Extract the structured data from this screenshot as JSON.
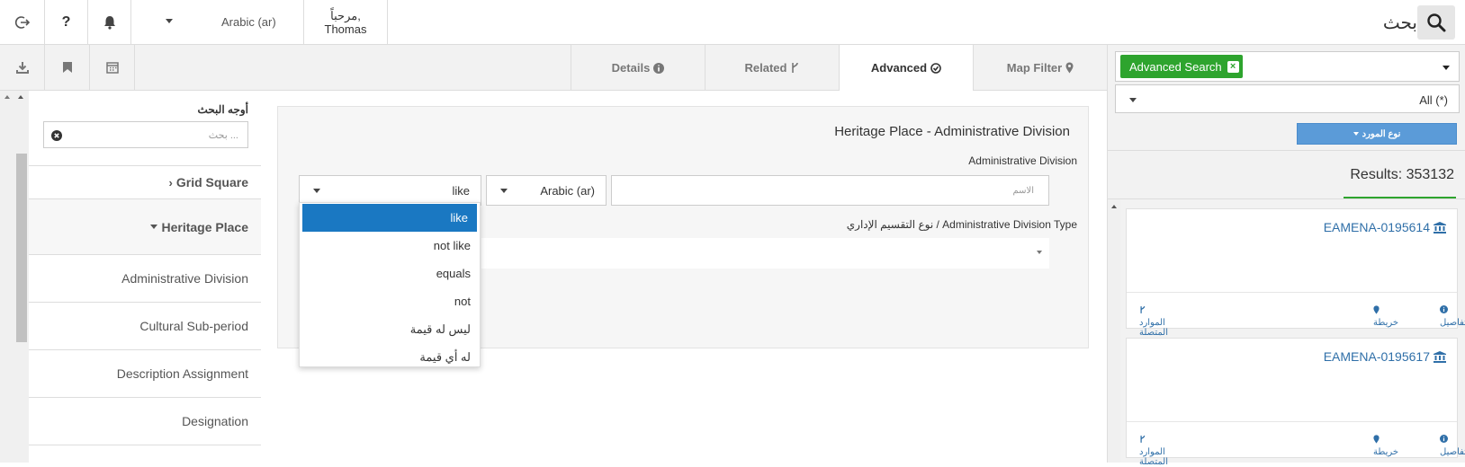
{
  "topbar": {
    "greeting": "مرحباً,",
    "user": "Thomas",
    "language": "Arabic (ar)",
    "search_title": "بحث"
  },
  "icons": {
    "logout": "logout-icon",
    "help": "question-icon",
    "bell": "bell-icon",
    "search": "search-icon",
    "download": "download-icon",
    "bookmark": "bookmark-icon",
    "calendar": "calendar-icon"
  },
  "tabs": [
    {
      "label": "Details",
      "icon": "info-icon"
    },
    {
      "label": "Related",
      "icon": "fork-icon"
    },
    {
      "label": "Advanced",
      "icon": "check-circle-icon",
      "active": true
    },
    {
      "label": "Map Filter",
      "icon": "map-marker-icon"
    }
  ],
  "facets": {
    "title": "أوجه البحث",
    "search_placeholder": "بحث ...",
    "items": [
      {
        "label": "Grid Square",
        "type": "group",
        "expanded": false
      },
      {
        "label": "Heritage Place",
        "type": "group",
        "expanded": true
      },
      {
        "label": "Administrative Division",
        "type": "item"
      },
      {
        "label": "Cultural Sub-period",
        "type": "item"
      },
      {
        "label": "Description Assignment",
        "type": "item"
      },
      {
        "label": "Designation",
        "type": "item"
      }
    ]
  },
  "advanced": {
    "card_title": "Heritage Place - Administrative Division",
    "field_label": "Administrative Division",
    "operator_value": "like",
    "language_value": "Arabic (ar)",
    "name_placeholder": "الاسم",
    "type_label": "نوع التقسيم الإداري / Administrative Division Type",
    "operator_options": [
      "like",
      "not like",
      "equals",
      "not",
      "ليس له قيمة",
      "له أي قيمة"
    ],
    "selected_option_index": 0
  },
  "right": {
    "filter_tag": "Advanced Search",
    "all_select": "All (*)",
    "resource_type_button": "نوع المورد",
    "results_label": "Results: 353132",
    "results": [
      {
        "title": "EAMENA-0195614",
        "details": "تفاصيل",
        "map": "خريطة",
        "related": "الموارد المتصلة"
      },
      {
        "title": "EAMENA-0195617",
        "details": "تفاصيل",
        "map": "خريطة",
        "related": "الموارد المتصلة"
      }
    ]
  },
  "colors": {
    "accent_blue": "#1a78c2",
    "button_blue": "#5b9bd8",
    "tag_green": "#2ea42e",
    "link_blue": "#2f6fa8"
  }
}
